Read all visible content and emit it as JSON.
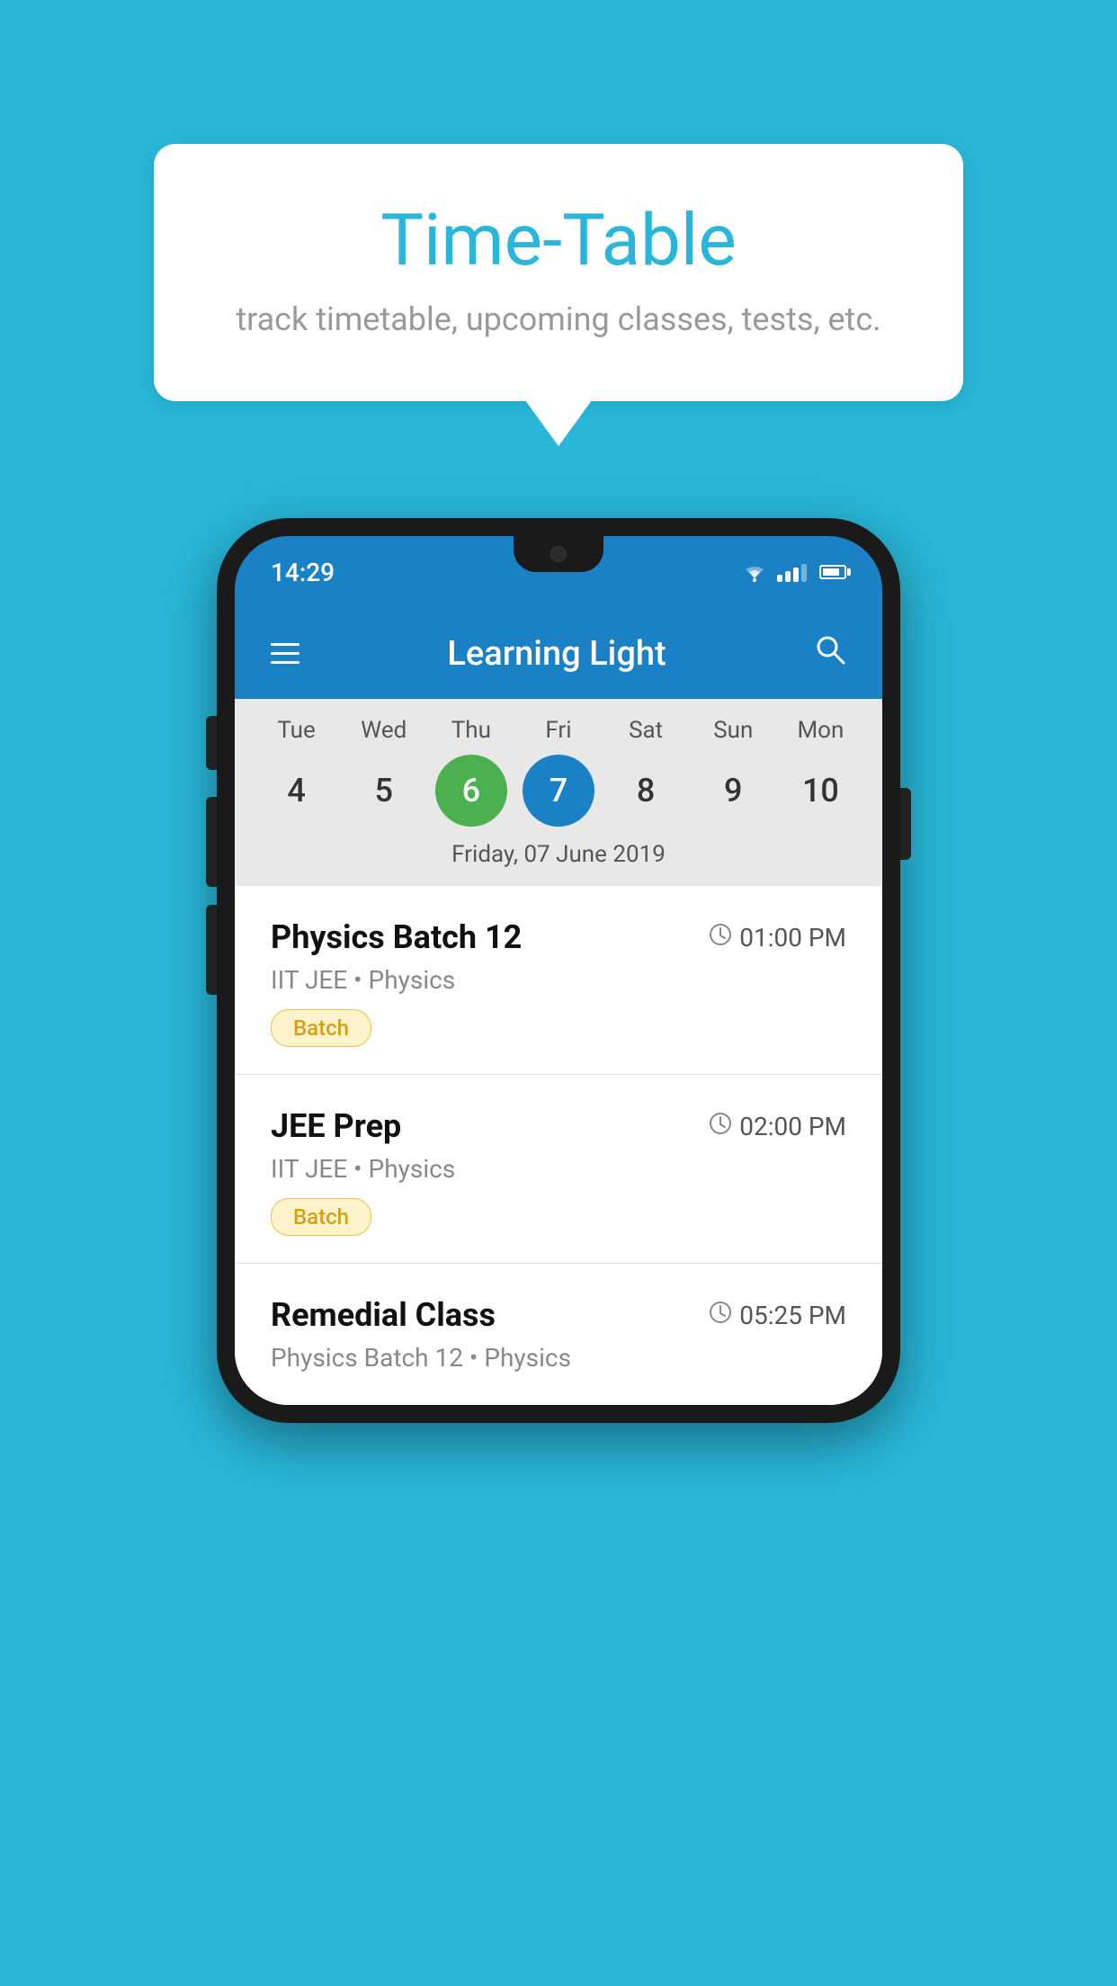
{
  "background_color": "#29b6d8",
  "tooltip": {
    "title": "Time-Table",
    "subtitle": "track timetable, upcoming classes, tests, etc."
  },
  "phone": {
    "status_bar": {
      "time": "14:29",
      "signal_bars": [
        6,
        10,
        14,
        18,
        22
      ],
      "battery_percent": 70
    },
    "app_header": {
      "title": "Learning Light",
      "menu_label": "menu",
      "search_label": "search"
    },
    "calendar": {
      "weekdays": [
        "Tue",
        "Wed",
        "Thu",
        "Fri",
        "Sat",
        "Sun",
        "Mon"
      ],
      "dates": [
        {
          "day": "4",
          "state": "normal"
        },
        {
          "day": "5",
          "state": "normal"
        },
        {
          "day": "6",
          "state": "today"
        },
        {
          "day": "7",
          "state": "selected"
        },
        {
          "day": "8",
          "state": "normal"
        },
        {
          "day": "9",
          "state": "normal"
        },
        {
          "day": "10",
          "state": "normal"
        }
      ],
      "selected_date_label": "Friday, 07 June 2019"
    },
    "schedule": {
      "items": [
        {
          "title": "Physics Batch 12",
          "time": "01:00 PM",
          "subtitle": "IIT JEE • Physics",
          "badge": "Batch"
        },
        {
          "title": "JEE Prep",
          "time": "02:00 PM",
          "subtitle": "IIT JEE • Physics",
          "badge": "Batch"
        },
        {
          "title": "Remedial Class",
          "time": "05:25 PM",
          "subtitle": "Physics Batch 12 • Physics",
          "badge": null
        }
      ]
    }
  }
}
